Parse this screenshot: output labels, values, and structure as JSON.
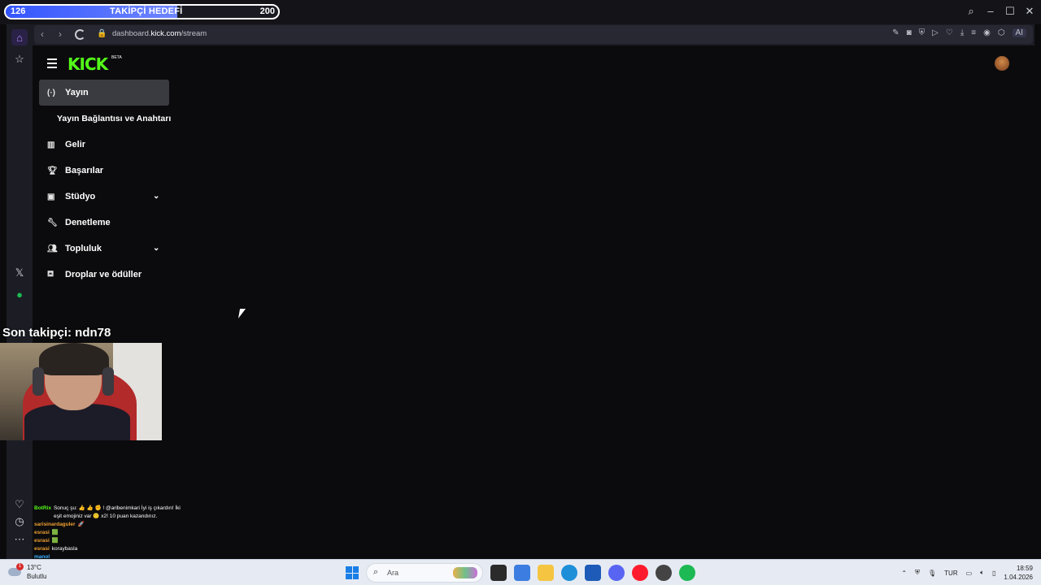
{
  "overlay": {
    "goal_current": "126",
    "goal_label": "TAKİPÇİ HEDEFİ",
    "goal_target": "200",
    "goal_progress": 0.63,
    "last_follower": "Son takipçi: ndn78"
  },
  "browser": {
    "url_prefix": "dashboard.",
    "url_domain": "kick.com",
    "url_path": "/stream",
    "ai_label": "AI"
  },
  "kick": {
    "logo": "KICK",
    "beta": "BETA",
    "menu": [
      {
        "label": "Yayın",
        "icon": "broadcast-icon"
      },
      {
        "label": "Yayın Bağlantısı ve Anahtarı"
      },
      {
        "label": "Gelir",
        "icon": "chart-icon"
      },
      {
        "label": "Başarılar",
        "icon": "trophy-icon"
      },
      {
        "label": "Stüdyo",
        "icon": "studio-icon"
      },
      {
        "label": "Denetleme",
        "icon": "wrench-icon"
      },
      {
        "label": "Topluluk",
        "icon": "community-icon"
      },
      {
        "label": "Droplar ve ödüller",
        "icon": "gift-icon"
      }
    ]
  },
  "chat": [
    {
      "user": "BotRix",
      "text": "Sonuç şu: 👍 👍 ✊ ! @aribenimkari İyi iş çıkardın! İki eşit emojiniz var 🙂 x2! 10 puan kazandınız."
    },
    {
      "user": "sarisinardaguler",
      "text": "🚀"
    },
    {
      "user": "esrasi",
      "text": "🟩"
    },
    {
      "user": "esrasi",
      "text": "🟩"
    },
    {
      "user": "esrasi",
      "text": "koraybasla"
    },
    {
      "user": "manol",
      "text": ""
    }
  ],
  "taskbar": {
    "temperature": "13°C",
    "condition": "Bulutlu",
    "weather_badge": "1",
    "search_placeholder": "Ara",
    "language": "TUR",
    "time": "18:59",
    "date": "1.04.2026"
  }
}
